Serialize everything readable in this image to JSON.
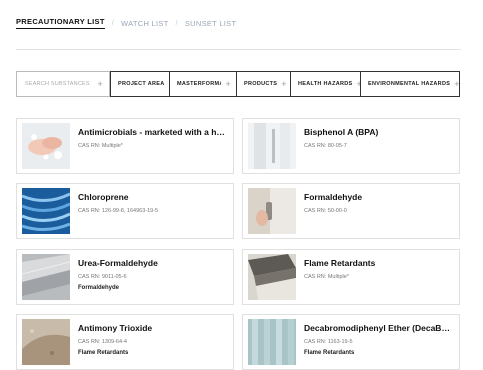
{
  "tabs": [
    {
      "label": "PRECAUTIONARY LIST",
      "active": true
    },
    {
      "label": "WATCH LIST",
      "active": false
    },
    {
      "label": "SUNSET LIST",
      "active": false
    }
  ],
  "filters": {
    "search_placeholder": "SEARCH SUBSTANCES",
    "buttons": [
      "PROJECT AREA",
      "MASTERFORMAT",
      "PRODUCTS",
      "HEALTH HAZARDS",
      "ENVIRONMENTAL HAZARDS"
    ]
  },
  "cards": [
    {
      "title": "Antimicrobials - marketed with a health claim",
      "cas": "CAS RN: Multiple*",
      "category": "",
      "thumb": "hands-washing-image"
    },
    {
      "title": "Bisphenol A (BPA)",
      "cas": "CAS RN: 80-05-7",
      "category": "",
      "thumb": "door-handle-image"
    },
    {
      "title": "Chloroprene",
      "cas": "CAS RN: 126-99-8, 164963-19-5",
      "category": "",
      "thumb": "network-cables-image"
    },
    {
      "title": "Formaldehyde",
      "cas": "CAS RN: 50-00-0",
      "category": "",
      "thumb": "cabinet-handle-image"
    },
    {
      "title": "Urea-Formaldehyde",
      "cas": "CAS RN: 9011-05-6",
      "category": "Formaldehyde",
      "thumb": "ceiling-panel-image"
    },
    {
      "title": "Flame Retardants",
      "cas": "CAS RN: Multiple*",
      "category": "",
      "thumb": "insulation-board-image"
    },
    {
      "title": "Antimony Trioxide",
      "cas": "CAS RN: 1309-64-4",
      "category": "Flame Retardants",
      "thumb": "carpet-fabric-image"
    },
    {
      "title": "Decabromodiphenyl Ether (DecaBDE)",
      "cas": "CAS RN: 1163-19-5",
      "category": "Flame Retardants",
      "thumb": "fabric-panel-image"
    }
  ]
}
